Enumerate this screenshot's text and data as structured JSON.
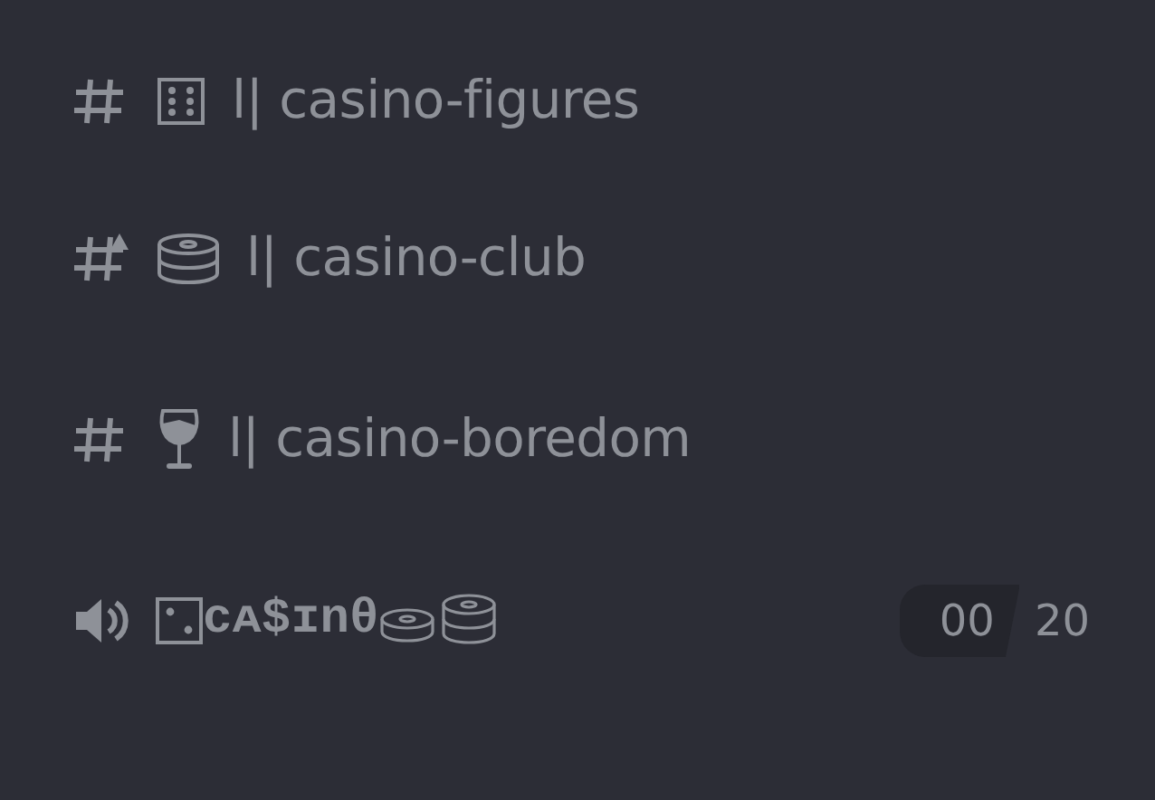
{
  "channels": [
    {
      "kind": "dice",
      "age_restricted": false,
      "name": "l| casino-figures"
    },
    {
      "kind": "chips",
      "age_restricted": true,
      "name": "l| casino-club"
    },
    {
      "kind": "wine",
      "age_restricted": false,
      "name": "l| casino-boredom"
    },
    {
      "kind": "voice",
      "name": "ᴄᴀ$ɪnθ",
      "user_count": "00",
      "user_limit": "20"
    }
  ]
}
